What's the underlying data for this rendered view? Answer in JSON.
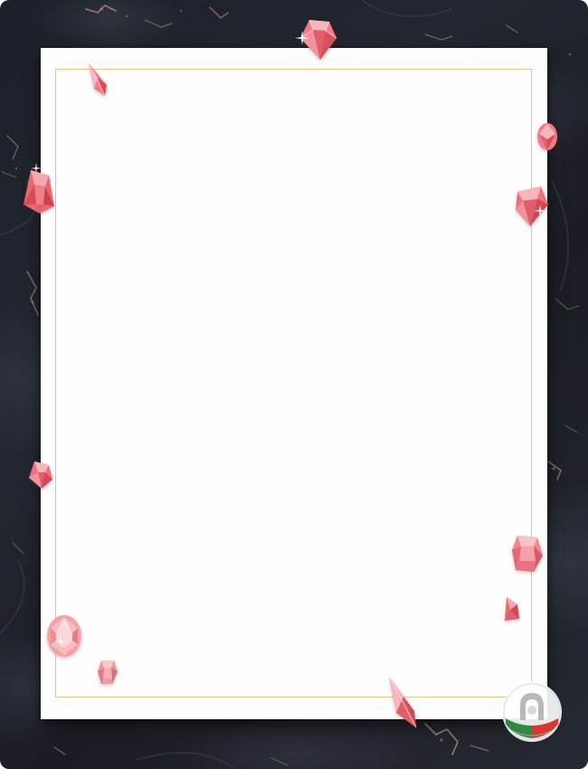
{
  "background": {
    "marble_color": "#1f232b",
    "vein_color": "#b88c74"
  },
  "card": {
    "paper_color": "#fefefe",
    "frame_color": "#e4c48c"
  },
  "gems": {
    "color": "#e8707a",
    "items": [
      {
        "name": "gem-top-center",
        "shape": "brilliant"
      },
      {
        "name": "gem-top-left-marquise",
        "shape": "marquise"
      },
      {
        "name": "gem-left-upper",
        "shape": "emerald"
      },
      {
        "name": "gem-right-upper-small",
        "shape": "oval"
      },
      {
        "name": "gem-right-upper-large",
        "shape": "brilliant"
      },
      {
        "name": "gem-left-middle",
        "shape": "emerald"
      },
      {
        "name": "gem-right-lower",
        "shape": "cushion"
      },
      {
        "name": "gem-right-lower-small",
        "shape": "pear"
      },
      {
        "name": "gem-bottom-left-round",
        "shape": "round"
      },
      {
        "name": "gem-bottom-left-small",
        "shape": "cushion"
      },
      {
        "name": "gem-bottom-marquise",
        "shape": "marquise"
      }
    ]
  },
  "logo": {
    "icon": "horseshoe-badge-icon",
    "flag_colors": [
      "#2e8b3e",
      "#ffffff",
      "#d43a32"
    ]
  }
}
